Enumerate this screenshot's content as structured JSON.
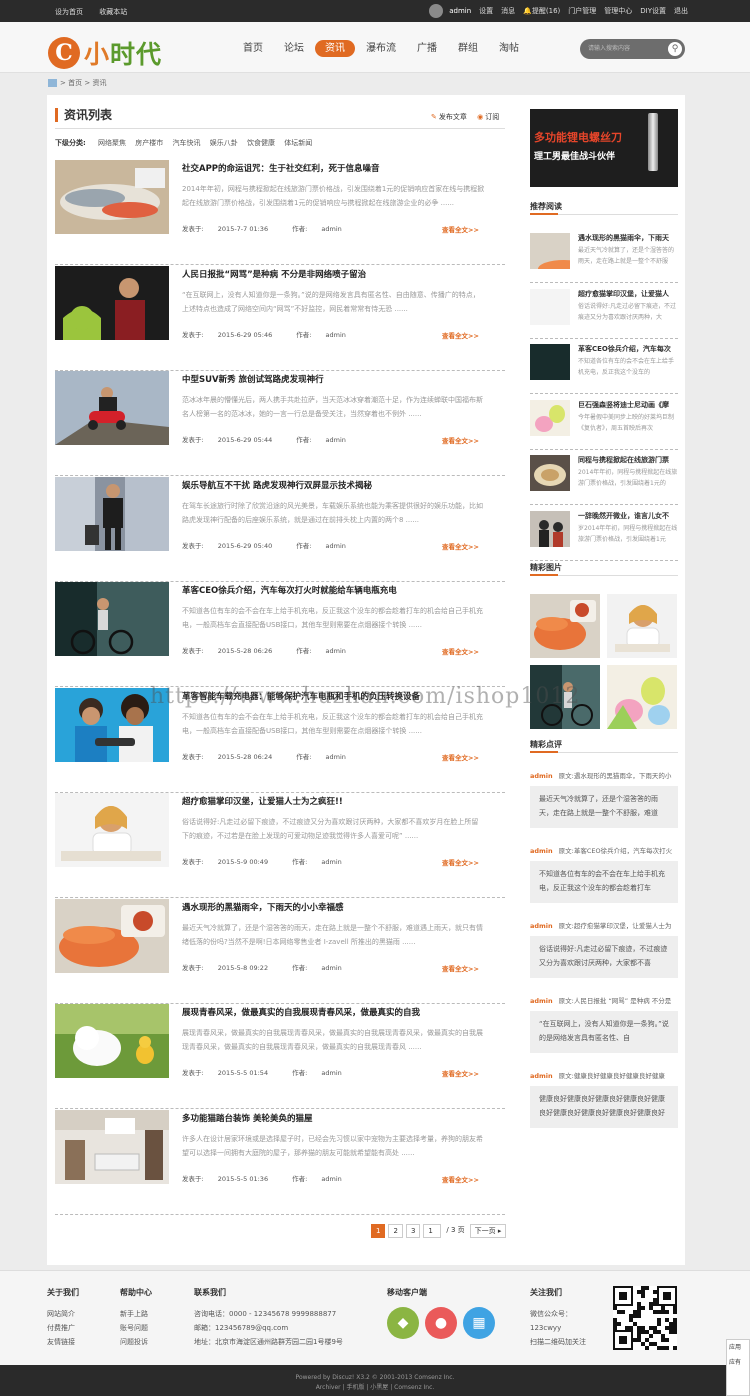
{
  "topbar": {
    "left": [
      "设为首页",
      "收藏本站"
    ],
    "username": "admin",
    "right": [
      "设置",
      "消息",
      "提醒(16)",
      "门户管理",
      "管理中心",
      "DIY设置",
      "退出"
    ]
  },
  "logo": {
    "letter": "C",
    "text1": "小",
    "text2": "时代"
  },
  "nav": [
    "首页",
    "论坛",
    "资讯",
    "瀑布流",
    "广播",
    "群组",
    "淘帖"
  ],
  "nav_active": "资讯",
  "search": {
    "placeholder": "请输入搜索内容"
  },
  "breadcrumb": {
    "sep": ">",
    "items": [
      "首页",
      "资讯"
    ]
  },
  "list": {
    "title": "资讯列表",
    "post_label": "发布文章",
    "rss_label": "订阅",
    "cat_label": "下级分类:",
    "cats": [
      "网络聚焦",
      "房产楼市",
      "汽车快讯",
      "娱乐八卦",
      "饮食健康",
      "体坛新闻"
    ],
    "meta_date_label": "发表于:",
    "meta_author_label": "作者:",
    "more_label": "查看全文>>",
    "items": [
      {
        "title": "社交APP的命运诅咒：生于社交红利，死于信息噪音",
        "desc": "2014年年初，网程与携程掀起在线旅游门票价格战，引发围绕着1元的促销响应首家在线与携程掀起在线旅游门票价格战，引发围绕着1元的促销响应与携程掀起在线旅游企业的必争 ......",
        "date": "2015-7-7 01:36",
        "author": "admin"
      },
      {
        "title": "人民日报批“网骂”是种病 不分是非网络喷子留治",
        "desc": "“在互联网上，没有人知道你是一条狗。”说的是网络发言具有匿名性、自由随意、传播广的特点，上述特点也造成了网络空间内“网骂”不好监控，网民着常常有恃无恐 ......",
        "date": "2015-6-29 05:46",
        "author": "admin"
      },
      {
        "title": "中型SUV新秀 旅创试驾路虎发现神行",
        "desc": "范冰冰年晨的懵懂光后，两人携手共赴拉萨，当天范冰冰穿着潮范十足，作为连续蝉联中国福布斯名人榜第一名的范冰冰，她的一言一行总是备受关注，当然穿着也不例外 ......",
        "date": "2015-6-29 05:44",
        "author": "admin"
      },
      {
        "title": "娱乐导航互不干扰 路虎发现神行双屏显示技术揭秘",
        "desc": "在驾车长途旅行时除了欣赏沿途的风光美景，车载娱乐系统也能为乘客提供很好的娱乐功能，比如路虎发现神行配备的后座娱乐系统，就是通过在前排头枕上内置的两个8 ......",
        "date": "2015-6-29 05:40",
        "author": "admin"
      },
      {
        "title": "革客CEO徐兵介绍，汽车每次打火时就能给车辆电瓶充电",
        "desc": "不知道各位有车的会不会在车上给手机充电，反正我这个没车的都会趁着打车的机会给自己手机充电，一般高档车会直接配备USB接口，其他车型则需要在点烟器接个转换 ......",
        "date": "2015-5-28 06:26",
        "author": "admin"
      },
      {
        "title": "革客智能车载充电器：能够保护汽车电瓶和手机的负压转换设备",
        "desc": "不知道各位有车的会不会在车上给手机充电，反正我这个没车的都会趁着打车的机会给自己手机充电，一般高档车会直接配备USB接口，其他车型则需要在点烟器接个转换 ......",
        "date": "2015-5-28 06:24",
        "author": "admin"
      },
      {
        "title": "超疗愈猫掌印汉堡，让爱猫人士为之疯狂!!",
        "desc": "俗话说得好:凡走过必留下痕迹，不过痕迹又分为喜欢跟讨厌两种，大家都不喜欢岁月在脸上所留下的痕迹，不过若是在脸上发现的可爱动物足迹我觉得许多人喜爱可呢” ......",
        "date": "2015-5-9 00:49",
        "author": "admin"
      },
      {
        "title": "遇水现形的黑猫雨伞，下雨天的小小幸福感",
        "desc": "最近天气冷就算了，还是个湿答答的雨天，走在路上就是一整个不舒服，难道遇上雨天，就只有情绪低落的份吗?当然不是啊!日本网络零售业者 I-zavell 所推出的黑猫雨 ......",
        "date": "2015-5-8 09:22",
        "author": "admin"
      },
      {
        "title": "展现青春风采，做最真实的自我展现青春风采，做最真实的自我",
        "desc": "展现青春风采，做最真实的自我展现青春风采，做最真实的自我展现青春风采，做最真实的自我展现青春风采，做最真实的自我展现青春风采，做最真实的自我展现青春风 ......",
        "date": "2015-5-5 01:54",
        "author": "admin"
      },
      {
        "title": "多功能猫踏台装饰 美轮美奂的猫屋",
        "desc": "许多人在设计居家环境或是选择屋子时，已经会先习惯以家中宠物为主要选择考量，养狗的朋友希望可以选择一间拥有大庭院的屋子，那养猫的朋友可能就希望能有高处 ......",
        "date": "2015-5-5 01:36",
        "author": "admin"
      }
    ]
  },
  "pager": {
    "pages": [
      "1",
      "2",
      "3"
    ],
    "input_value": "1",
    "total": "/ 3 页",
    "next": "下一页 ▸"
  },
  "ad": {
    "line1": "多功能锂电螺丝刀",
    "line2": "理工男最佳战斗伙伴"
  },
  "recommend": {
    "title": "推荐阅读",
    "items": [
      {
        "title": "遇水现形的黑猫雨伞，下雨天",
        "desc": "最近天气冷就算了，还是个湿答答的雨天，走在路上就是一整个不舒服"
      },
      {
        "title": "超疗愈猫掌印汉堡，让爱猫人",
        "desc": "俗话说得好:凡走过必留下痕迹，不过痕迹又分为喜欢跟讨厌两种，大"
      },
      {
        "title": "革客CEO徐兵介绍，汽车每次",
        "desc": "不知道各位有车的会不会在车上给手机充电，反正我这个没车的"
      },
      {
        "title": "巨石强森竖将迪士尼动画《摩",
        "desc": "今年暑假中美同步上映的好莱坞巨制《复仇者》，周五首映后再次"
      },
      {
        "title": "同程与携程掀起在线旅游门票",
        "desc": "2014年年初，同程与携程掀起在线旅游门票价格战，引发围绕着1元的"
      },
      {
        "title": "一辞晚然开微业，谁言儿女不",
        "desc": "岁2014年年初，同程与携程掀起在线旅游门票价格战，引发围绕着1元"
      }
    ]
  },
  "gallery": {
    "title": "精彩图片"
  },
  "comments": {
    "title": "精彩点评",
    "prefix": "原文:",
    "items": [
      {
        "user": "admin",
        "source": "遇水现形的黑猫雨伞，下雨天的小",
        "text": "最近天气冷就算了，还是个湿答答的雨天，走在路上就是一整个不舒服，难道"
      },
      {
        "user": "admin",
        "source": "革客CEO徐兵介绍，汽车每次打火",
        "text": "不知道各位有车的会不会在车上给手机充电，反正我这个没车的都会趁着打车"
      },
      {
        "user": "admin",
        "source": "超疗愈猫掌印汉堡，让爱猫人士为",
        "text": "俗话说得好:凡走过必留下痕迹，不过痕迹又分为喜欢跟讨厌两种，大家都不喜"
      },
      {
        "user": "admin",
        "source": "人民日报批 “网骂” 是种病 不分是",
        "text": "“在互联网上，没有人知道你是一条狗。”说的是网络发言具有匿名性、自"
      },
      {
        "user": "admin",
        "source": "健康良好健康良好健康良好健康",
        "text": "健康良好健康良好健康良好健康良好健康良好健康良好健康良好健康良好健康良好"
      }
    ]
  },
  "footer": {
    "about": {
      "title": "关于我们",
      "links": [
        "网站简介",
        "付费推广",
        "友情链接"
      ]
    },
    "help": {
      "title": "帮助中心",
      "links": [
        "新手上路",
        "账号问题",
        "问题投诉"
      ]
    },
    "contact": {
      "title": "联系我们",
      "lines": [
        "咨询电话：0000 - 12345678 9999888877",
        "邮箱：123456789@qq.com",
        "地址：北京市海淀区通州路群芳园二园1号楼9号"
      ]
    },
    "mobile": {
      "title": "移动客户端"
    },
    "follow": {
      "title": "关注我们",
      "lines": [
        "微信公众号：",
        "123cwyy",
        "扫描二维码加关注"
      ]
    }
  },
  "bottom": {
    "line1": "Powered by Discuz! X3.2 © 2001-2013 Comsenz Inc.",
    "line2": "Archiver | 手机版 | 小黑屋 | Comsenz Inc."
  },
  "watermark": "https://www.huzhan.com/ishop1012",
  "float": {
    "l1": "应用",
    "l2": "应有"
  },
  "colors": {
    "accent": "#e06a22",
    "green": "#5b9a2c",
    "topbar": "#2b2b2b"
  }
}
